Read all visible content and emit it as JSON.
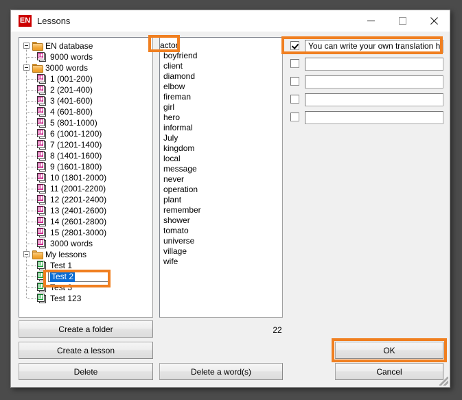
{
  "window": {
    "title": "Lessons",
    "logo_text": "EN",
    "controls": {
      "minimize": "minimize-icon",
      "maximize": "maximize-icon",
      "close": "close-icon"
    }
  },
  "tree": {
    "nodes": [
      {
        "label": "EN database",
        "type": "folder",
        "level": 0,
        "expander": "collapse"
      },
      {
        "label": "9000 words",
        "type": "doc-red",
        "level": 1
      },
      {
        "label": "3000 words",
        "type": "folder",
        "level": 0,
        "expander": "collapse"
      },
      {
        "label": "1 (001-200)",
        "type": "doc-red",
        "level": 1
      },
      {
        "label": "2 (201-400)",
        "type": "doc-red",
        "level": 1
      },
      {
        "label": "3 (401-600)",
        "type": "doc-red",
        "level": 1
      },
      {
        "label": "4 (601-800)",
        "type": "doc-red",
        "level": 1
      },
      {
        "label": "5 (801-1000)",
        "type": "doc-red",
        "level": 1
      },
      {
        "label": "6 (1001-1200)",
        "type": "doc-red",
        "level": 1
      },
      {
        "label": "7 (1201-1400)",
        "type": "doc-red",
        "level": 1
      },
      {
        "label": "8 (1401-1600)",
        "type": "doc-red",
        "level": 1
      },
      {
        "label": "9 (1601-1800)",
        "type": "doc-red",
        "level": 1
      },
      {
        "label": "10 (1801-2000)",
        "type": "doc-red",
        "level": 1
      },
      {
        "label": "11 (2001-2200)",
        "type": "doc-red",
        "level": 1
      },
      {
        "label": "12 (2201-2400)",
        "type": "doc-red",
        "level": 1
      },
      {
        "label": "13 (2401-2600)",
        "type": "doc-red",
        "level": 1
      },
      {
        "label": "14 (2601-2800)",
        "type": "doc-red",
        "level": 1
      },
      {
        "label": "15 (2801-3000)",
        "type": "doc-red",
        "level": 1
      },
      {
        "label": "3000 words",
        "type": "doc-red",
        "level": 1
      },
      {
        "label": "My lessons",
        "type": "folder",
        "level": 0,
        "expander": "collapse"
      },
      {
        "label": "Test 1",
        "type": "doc-green",
        "level": 1
      },
      {
        "label": "Test 2",
        "type": "doc-green",
        "level": 1,
        "selected": true,
        "editing": true
      },
      {
        "label": "Test 3",
        "type": "doc-green",
        "level": 1
      },
      {
        "label": "Test 123",
        "type": "doc-green",
        "level": 1
      }
    ]
  },
  "word_list": {
    "words": [
      "actor",
      "boyfriend",
      "client",
      "diamond",
      "elbow",
      "fireman",
      "girl",
      "hero",
      "informal",
      "July",
      "kingdom",
      "local",
      "message",
      "never",
      "operation",
      "plant",
      "remember",
      "shower",
      "tomato",
      "universe",
      "village",
      "wife"
    ],
    "selected": "actor",
    "count": "22"
  },
  "translations": {
    "rows": [
      {
        "checked": true,
        "value": "You can write your own translation here"
      },
      {
        "checked": false,
        "value": ""
      },
      {
        "checked": false,
        "value": ""
      },
      {
        "checked": false,
        "value": ""
      },
      {
        "checked": false,
        "value": ""
      }
    ]
  },
  "buttons": {
    "create_folder": "Create a folder",
    "create_lesson": "Create a lesson",
    "delete": "Delete",
    "delete_words": "Delete a word(s)",
    "ok": "OK",
    "cancel": "Cancel"
  },
  "annotations": {
    "color": "#f07f20",
    "targets": [
      "selected-word",
      "tree-selected-node",
      "translation-row-1",
      "ok-button"
    ]
  }
}
